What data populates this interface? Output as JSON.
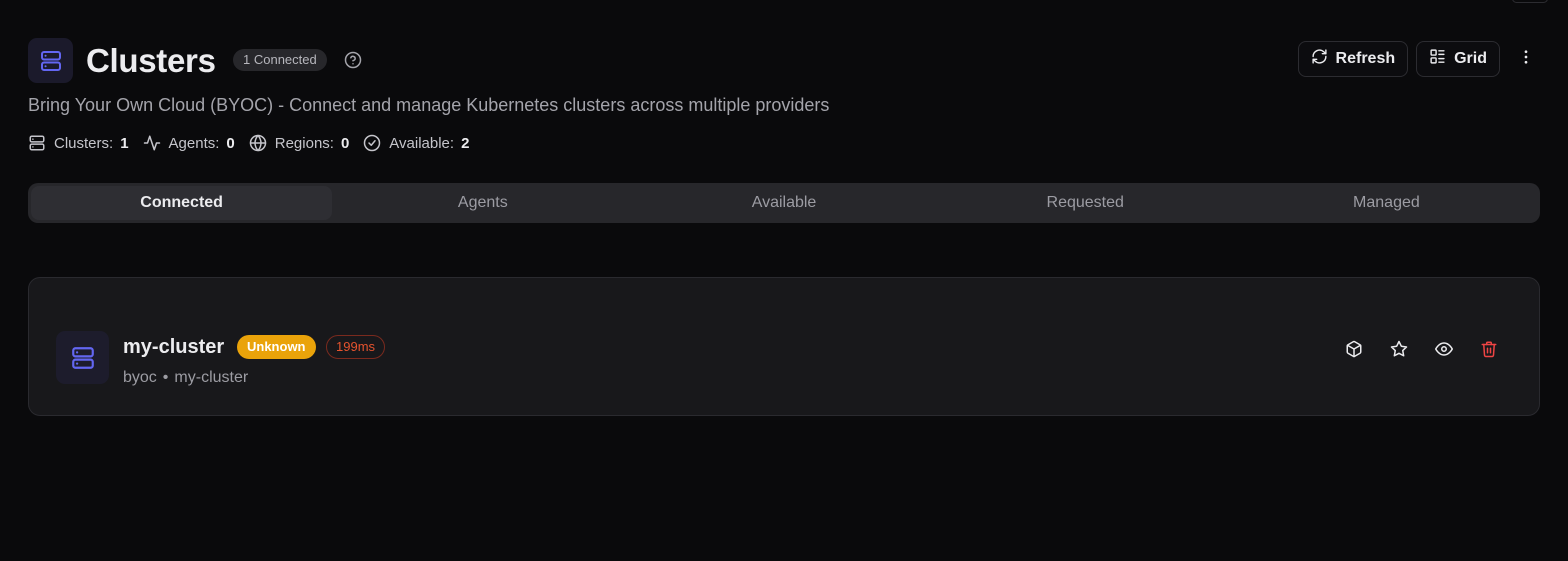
{
  "header": {
    "title": "Clusters",
    "connected_badge": "1 Connected",
    "subtitle": "Bring Your Own Cloud (BYOC) - Connect and manage Kubernetes clusters across multiple providers"
  },
  "toolbar": {
    "refresh_label": "Refresh",
    "grid_label": "Grid"
  },
  "stats": [
    {
      "label": "Clusters:",
      "value": "1",
      "icon": "server-icon"
    },
    {
      "label": "Agents:",
      "value": "0",
      "icon": "activity-icon"
    },
    {
      "label": "Regions:",
      "value": "0",
      "icon": "globe-icon"
    },
    {
      "label": "Available:",
      "value": "2",
      "icon": "check-circle-icon"
    }
  ],
  "tabs": [
    {
      "label": "Connected",
      "active": true
    },
    {
      "label": "Agents",
      "active": false
    },
    {
      "label": "Available",
      "active": false
    },
    {
      "label": "Requested",
      "active": false
    },
    {
      "label": "Managed",
      "active": false
    }
  ],
  "clusters": [
    {
      "name": "my-cluster",
      "status": "Unknown",
      "latency": "199ms",
      "provider": "byoc",
      "separator": "•",
      "id": "my-cluster",
      "actions": [
        "package-icon",
        "star-icon",
        "eye-icon",
        "trash-icon"
      ]
    }
  ],
  "colors": {
    "background": "#0a0a0c",
    "accent": "#6366f1",
    "status_unknown": "#eaa30a",
    "latency": "#e5532e",
    "danger": "#ef4444"
  }
}
